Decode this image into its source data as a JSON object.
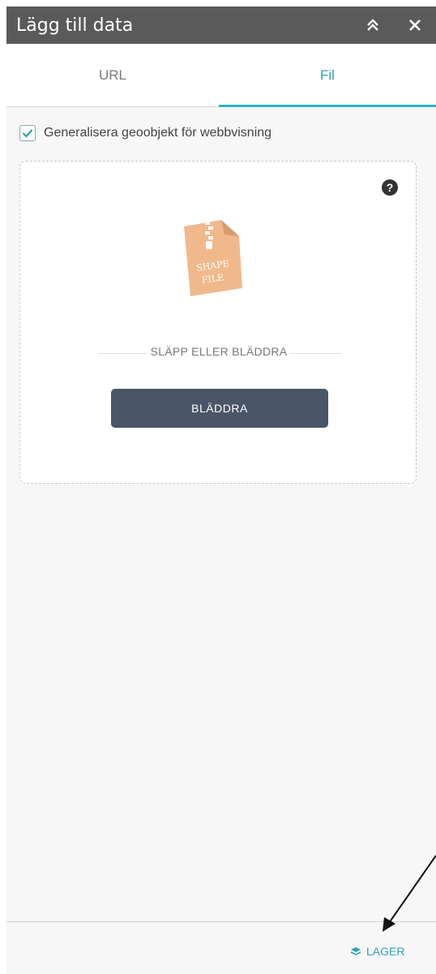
{
  "window": {
    "title": "Lägg till data",
    "collapse_icon": "double-chevron-up-icon",
    "close_icon": "close-icon"
  },
  "tabs": [
    {
      "label": "URL",
      "active": false
    },
    {
      "label": "Fil",
      "active": true
    }
  ],
  "options": {
    "generalize_label": "Generalisera geoobjekt för webbvisning",
    "generalize_checked": true
  },
  "dropzone": {
    "help_icon": "question-icon",
    "file_icon": "shapefile-zip-icon",
    "file_icon_text_line1": "SHAPE",
    "file_icon_text_line2": "FILE",
    "drop_text": "SLÄPP ELLER BLÄDDRA",
    "browse_label": "BLÄDDRA"
  },
  "footer": {
    "layers_label": "LAGER",
    "layers_icon": "layers-icon"
  },
  "colors": {
    "title_bar": "#5a5a5a",
    "accent": "#2aa3b8",
    "button": "#4a5567",
    "file_icon": "#f0b98c"
  }
}
